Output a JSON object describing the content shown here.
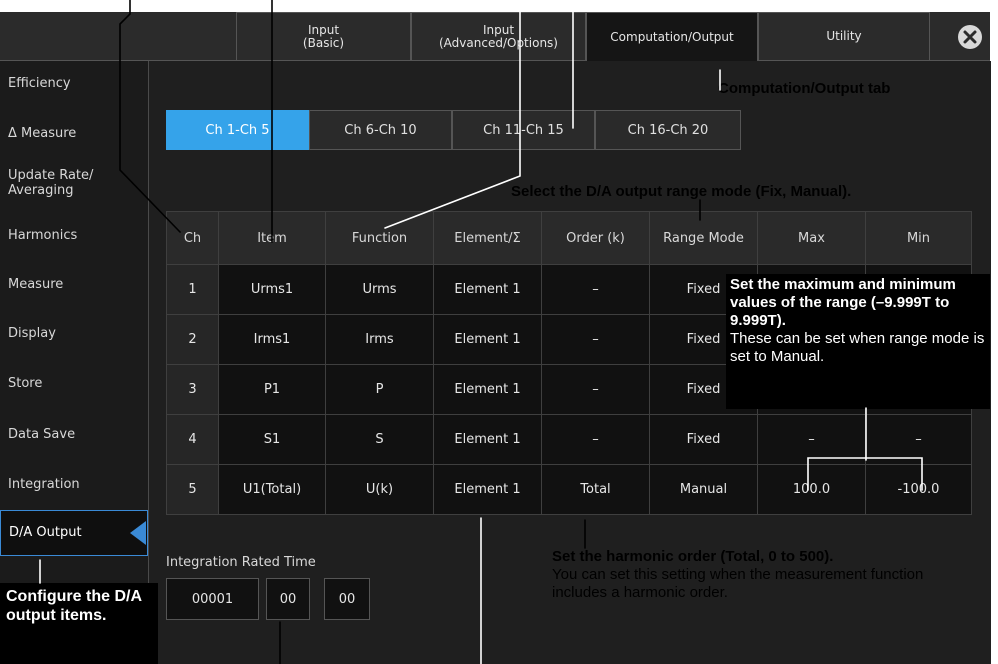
{
  "tabs": [
    {
      "label": "Input\n(Basic)"
    },
    {
      "label": "Input\n(Advanced/Options)"
    },
    {
      "label": "Computation/Output"
    },
    {
      "label": "Utility"
    }
  ],
  "sidebar": {
    "items": [
      {
        "label": "Efficiency"
      },
      {
        "label": "Δ Measure"
      },
      {
        "label": "Update Rate/\nAveraging"
      },
      {
        "label": "Harmonics"
      },
      {
        "label": "Measure"
      },
      {
        "label": "Display"
      },
      {
        "label": "Store"
      },
      {
        "label": "Data Save"
      },
      {
        "label": "Integration"
      },
      {
        "label": "D/A Output"
      }
    ]
  },
  "channel_tabs": [
    "Ch 1-Ch 5",
    "Ch 6-Ch 10",
    "Ch 11-Ch 15",
    "Ch 16-Ch 20"
  ],
  "table": {
    "headers": [
      "Ch",
      "Item",
      "Function",
      "Element/Σ",
      "Order (k)",
      "Range Mode",
      "Max",
      "Min"
    ],
    "rows": [
      [
        "1",
        "Urms1",
        "Urms",
        "Element 1",
        "–",
        "Fixed",
        "",
        ""
      ],
      [
        "2",
        "Irms1",
        "Irms",
        "Element 1",
        "–",
        "Fixed",
        "",
        ""
      ],
      [
        "3",
        "P1",
        "P",
        "Element 1",
        "–",
        "Fixed",
        "",
        ""
      ],
      [
        "4",
        "S1",
        "S",
        "Element 1",
        "–",
        "Fixed",
        "–",
        "–"
      ],
      [
        "5",
        "U1(Total)",
        "U(k)",
        "Element 1",
        "Total",
        "Manual",
        "100.0",
        "-100.0"
      ]
    ]
  },
  "integration": {
    "label": "Integration Rated Time",
    "hours": "00001",
    "minutes": "00",
    "seconds": "00"
  },
  "annotations": {
    "tab_label": "Computation/Output tab",
    "range_mode": "Select the D/A output range mode (Fix, Manual).",
    "max_min_bold": "Set the maximum and minimum values of the range (–9.999T to 9.999T).",
    "max_min_normal": "These can be set when range mode is set to Manual.",
    "order_bold": "Set the harmonic order (Total, 0 to 500).",
    "order_normal": "You can set this setting when the measurement function includes a harmonic order.",
    "configure": "Configure the D/A output items."
  },
  "colors": {
    "accent": "#35a3ea",
    "background": "#1b1b1b"
  },
  "icons": {
    "close": "close-icon"
  }
}
